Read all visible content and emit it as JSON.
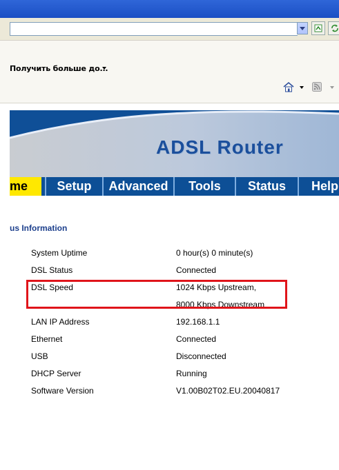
{
  "browser": {
    "links_label": "Получить больше до...",
    "icons": [
      "chevron-down-icon",
      "go-icon",
      "refresh-icon",
      "home-icon",
      "feed-icon"
    ]
  },
  "router": {
    "banner_title": "ADSL Router",
    "tabs": [
      {
        "label": "me",
        "active": true
      },
      {
        "label": "Setup",
        "active": false
      },
      {
        "label": "Advanced",
        "active": false
      },
      {
        "label": "Tools",
        "active": false
      },
      {
        "label": "Status",
        "active": false
      },
      {
        "label": "Help",
        "active": false
      }
    ],
    "colors": {
      "banner_blue": "#0f4f97",
      "active_tab": "#ffe800",
      "section_title": "#1c3f8c",
      "highlight": "#e0141a"
    }
  },
  "status": {
    "section_title": "us Information",
    "rows": [
      {
        "label": "System Uptime",
        "value": "0 hour(s) 0 minute(s)"
      },
      {
        "label": "DSL Status",
        "value": "Connected"
      },
      {
        "label": "DSL Speed",
        "value": "1024 Kbps Upstream,"
      },
      {
        "label": "",
        "value": "8000 Kbps Downstream"
      },
      {
        "label": "LAN IP Address",
        "value": "192.168.1.1"
      },
      {
        "label": "Ethernet",
        "value": "Connected"
      },
      {
        "label": "USB",
        "value": "Disconnected"
      },
      {
        "label": "DHCP Server",
        "value": "Running"
      },
      {
        "label": "Software Version",
        "value": "V1.00B02T02.EU.20040817"
      }
    ]
  }
}
